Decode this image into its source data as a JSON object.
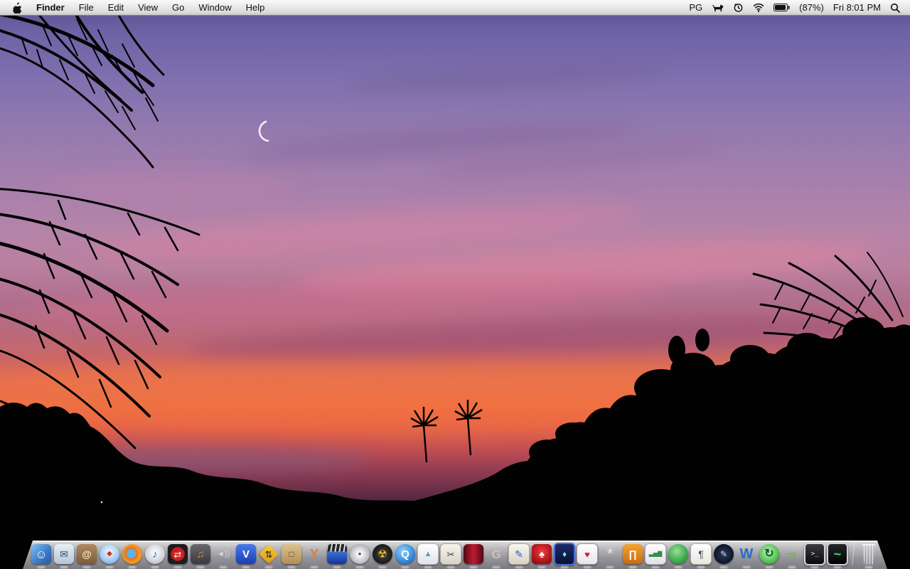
{
  "menu_bar": {
    "menus": [
      "Finder",
      "File",
      "Edit",
      "View",
      "Go",
      "Window",
      "Help"
    ],
    "status": {
      "user_initials": "PG",
      "battery_percent": "(87%)",
      "clock": "Fri 8:01 PM"
    },
    "status_icon_names": [
      "dog-icon",
      "time-machine-icon",
      "wifi-icon",
      "battery-icon",
      "spotlight-icon"
    ],
    "apple_icon_name": "apple-logo-icon"
  },
  "desktop": {
    "wallpaper_scene": "sunset sky with palm frond and tree silhouettes, crescent moon",
    "colors": {
      "sky_top_purple": "#6e63a6",
      "sky_pink": "#b684a8",
      "sunset_orange": "#ef7245",
      "dusk_red": "#8e3b52",
      "silhouette": "#020202",
      "moon": "#f6eef2"
    }
  },
  "dock": {
    "items": [
      {
        "name": "finder",
        "label": "Finder",
        "glyph": "☺",
        "color": "#ffffff",
        "size": 17,
        "shape": "rounded",
        "bg": "linear-gradient(135deg,#86c0ee,#3a78c8 60%,#2a5aa8)"
      },
      {
        "name": "mail",
        "label": "Mail",
        "glyph": "✉",
        "color": "#31506e",
        "size": 14,
        "shape": "rounded",
        "bg": "linear-gradient(#e8eef5,#b6c6d6)"
      },
      {
        "name": "address-book",
        "label": "Address Book",
        "glyph": "@",
        "color": "#f4e4c0",
        "size": 14,
        "bold": true,
        "shape": "rounded",
        "bg": "linear-gradient(#b08a5e,#7c5c38)"
      },
      {
        "name": "safari",
        "label": "Safari",
        "glyph": "◆",
        "color": "#d42a2a",
        "size": 10,
        "shape": "circle",
        "bg": "radial-gradient(circle at 50% 38%,#f2f8ff,#a8cdef 55%,#5d92c4)"
      },
      {
        "name": "firefox",
        "label": "Firefox",
        "glyph": "",
        "shape": "circle",
        "bg": "radial-gradient(circle at 45% 48%,#5cb2ea 27%,#e8721c 35%,#f79d24 60%,#c85a10)"
      },
      {
        "name": "itunes",
        "label": "iTunes",
        "glyph": "♪",
        "color": "#2a66cc",
        "size": 15,
        "shape": "circle",
        "bg": "radial-gradient(circle at 50% 42%,#ffffff,#d2d7dd 55%,#9fa6b0)"
      },
      {
        "name": "crossed-arrows-app",
        "label": "Crossed arrows app",
        "glyph": "⇄",
        "color": "#ffffff",
        "size": 13,
        "shape": "rounded",
        "bg": "radial-gradient(circle,#cc1d1d 46%,#1c1c1e 52%)"
      },
      {
        "name": "garageband",
        "label": "GarageBand",
        "glyph": "♫",
        "color": "#d29040",
        "size": 15,
        "shape": "rounded",
        "bg": "linear-gradient(#68686e,#39393f)"
      },
      {
        "name": "audio-speaker-app",
        "label": "Audio utility",
        "glyph": "◄))",
        "color": "#d6d6dc",
        "size": 11,
        "shape": "none"
      },
      {
        "name": "vuze",
        "label": "Vuze",
        "glyph": "V",
        "color": "#ffffff",
        "size": 15,
        "bold": true,
        "shape": "rounded",
        "bg": "linear-gradient(#4a7ae8,#1c3cb4)"
      },
      {
        "name": "two-way-sign-app",
        "label": "Two-way arrows sign app",
        "glyph": "⇅",
        "color": "#1c1c1c",
        "size": 13,
        "shape": "diamond",
        "bg": "linear-gradient(135deg,#f6cc3c,#d9991a)"
      },
      {
        "name": "door-app",
        "label": "Door app",
        "glyph": "□",
        "color": "#54381e",
        "size": 12,
        "shape": "rounded",
        "bg": "linear-gradient(#dcc28e,#b28e58)"
      },
      {
        "name": "handbrake",
        "label": "HandBrake",
        "glyph": "Y",
        "color": "#e87a2a",
        "size": 18,
        "bold": true,
        "shape": "none"
      },
      {
        "name": "video-clip-app",
        "label": "Video clip editor",
        "glyph": "",
        "shape": "rounded",
        "bg": "repeating-linear-gradient(100deg,#dcdce0 0 2px,#26262a 2px 6px) top/100% 38% no-repeat,linear-gradient(#3a70d8,#16309a) bottom/100% 62% no-repeat"
      },
      {
        "name": "disc-ripper-app",
        "label": "Disc ripper",
        "glyph": "●",
        "color": "#4a4a4e",
        "size": 8,
        "shape": "circle",
        "bg": "radial-gradient(circle,#f2f2f4 20%,#c6c6cc 55%,#8e8e96)"
      },
      {
        "name": "burn",
        "label": "Burn",
        "glyph": "☢",
        "color": "#f2c218",
        "size": 15,
        "shape": "circle",
        "bg": "radial-gradient(circle,#333333 30%,#050505)"
      },
      {
        "name": "quicktime",
        "label": "QuickTime Player",
        "glyph": "Q",
        "color": "#ffffff",
        "size": 15,
        "bold": true,
        "shape": "circle",
        "bg": "radial-gradient(circle at 40% 35%,#93d2f8,#2e82da 65%,#1a5cb0)"
      },
      {
        "name": "iphoto",
        "label": "iPhoto",
        "glyph": "▲",
        "color": "#4a9ec4",
        "size": 11,
        "shape": "rounded",
        "bg": "linear-gradient(#ffffff,#dfe3e8)",
        "border": "1px solid #b8b8bc"
      },
      {
        "name": "photo-editor-app",
        "label": "Photo editor",
        "glyph": "✂",
        "color": "#3a3a3e",
        "size": 13,
        "shape": "rounded",
        "bg": "linear-gradient(#f6f3ee,#d9d2c8)",
        "border": "1px solid #b0a89c"
      },
      {
        "name": "theater-app",
        "label": "Movie theater app",
        "glyph": "",
        "shape": "rounded",
        "bg": "linear-gradient(90deg,#4e0810,#c21a32 50%,#4e0810)"
      },
      {
        "name": "gimp",
        "label": "GIMP",
        "glyph": "G",
        "color": "#cfc4ae",
        "size": 17,
        "bold": true,
        "shape": "none"
      },
      {
        "name": "paintbrush-app",
        "label": "Paint app",
        "glyph": "✎",
        "color": "#2a58cc",
        "size": 14,
        "shape": "rounded",
        "bg": "linear-gradient(#f8f6f0,#d8d2c4)",
        "border": "1px solid #b4ac9e"
      },
      {
        "name": "pokerstars",
        "label": "PokerStars",
        "glyph": "♠",
        "color": "#ffffff",
        "size": 15,
        "shape": "rounded",
        "bg": "radial-gradient(circle at 50% 40%,#ee4040,#a81018 70%,#6e0a10)"
      },
      {
        "name": "blue-flame-app",
        "label": "Blue flame app",
        "glyph": "♦",
        "color": "#6ee4f4",
        "size": 12,
        "shape": "rounded",
        "bg": "linear-gradient(#1c2a66,#0a1232)",
        "border": "2px solid #4a6ada"
      },
      {
        "name": "card-game-app",
        "label": "Card game",
        "glyph": "♥",
        "color": "#d22030",
        "size": 13,
        "shape": "rounded",
        "bg": "linear-gradient(#ffffff,#e6e6ea)",
        "border": "1px solid #9a9aa0"
      },
      {
        "name": "magic-hat-app",
        "label": "Magic hat app",
        "glyph": "*",
        "color": "#e6e6ee",
        "size": 22,
        "shape": "none"
      },
      {
        "name": "keynote",
        "label": "Keynote",
        "glyph": "∏",
        "color": "#ffffff",
        "size": 14,
        "bold": true,
        "shape": "rounded",
        "bg": "linear-gradient(#f4a432,#c66c10)"
      },
      {
        "name": "chart-app",
        "label": "Charts app",
        "glyph": "▃▅▇",
        "color": "#3a8a4e",
        "size": 8,
        "shape": "rounded",
        "bg": "linear-gradient(#fdfdfd,#e2e2e6)",
        "border": "1px solid #b0b0b6"
      },
      {
        "name": "neooffice",
        "label": "NeoOffice",
        "glyph": "",
        "shape": "circle",
        "bg": "radial-gradient(circle at 42% 36%,#96e096,#35a245 65%,#1b7c2b)"
      },
      {
        "name": "pages",
        "label": "Pages",
        "glyph": "¶",
        "color": "#44485a",
        "size": 14,
        "shape": "rounded",
        "bg": "linear-gradient(#ffffff,#e8e6de)",
        "border": "1px solid #b4b2a8"
      },
      {
        "name": "pen-journal-app",
        "label": "Writing app",
        "glyph": "✎",
        "color": "#d2d6e2",
        "size": 12,
        "shape": "circle",
        "bg": "radial-gradient(circle,#2c3c5e,#0a1222 75%)"
      },
      {
        "name": "microsoft-word",
        "label": "Microsoft Word",
        "glyph": "W",
        "color": "#2a6ac8",
        "size": 20,
        "bold": true,
        "shape": "none"
      },
      {
        "name": "sync-app",
        "label": "Sync utility",
        "glyph": "↻",
        "color": "#0c5a1c",
        "size": 16,
        "bold": true,
        "shape": "circle",
        "bg": "radial-gradient(circle at 45% 40%,#c2f2c2,#52c252 60%,#1e8e2e)"
      },
      {
        "name": "raygun-app",
        "label": "Ray gun app",
        "glyph": "¬",
        "color": "#76b845",
        "size": 20,
        "bold": true,
        "shape": "none"
      },
      {
        "name": "terminal",
        "label": "Terminal",
        "glyph": ">_",
        "color": "#e8e8e8",
        "size": 9,
        "mono": true,
        "shape": "rounded",
        "bg": "linear-gradient(#3c3c40,#0a0a0c)",
        "border": "2px solid #d6d6da"
      },
      {
        "name": "activity-monitor",
        "label": "Activity Monitor",
        "glyph": "~",
        "color": "#42e25e",
        "size": 18,
        "bold": true,
        "shape": "rounded",
        "bg": "linear-gradient(#26262a,#020204)",
        "border": "2px solid #cfcfd4"
      },
      {
        "type": "divider"
      },
      {
        "name": "trash",
        "label": "Trash",
        "glyph": "",
        "shape": "trash",
        "bg": "repeating-linear-gradient(90deg,rgba(255,255,255,.7) 0 1px,rgba(170,170,180,.35) 1px 4px),linear-gradient(rgba(230,230,238,.5),rgba(150,150,160,.4))"
      }
    ]
  }
}
